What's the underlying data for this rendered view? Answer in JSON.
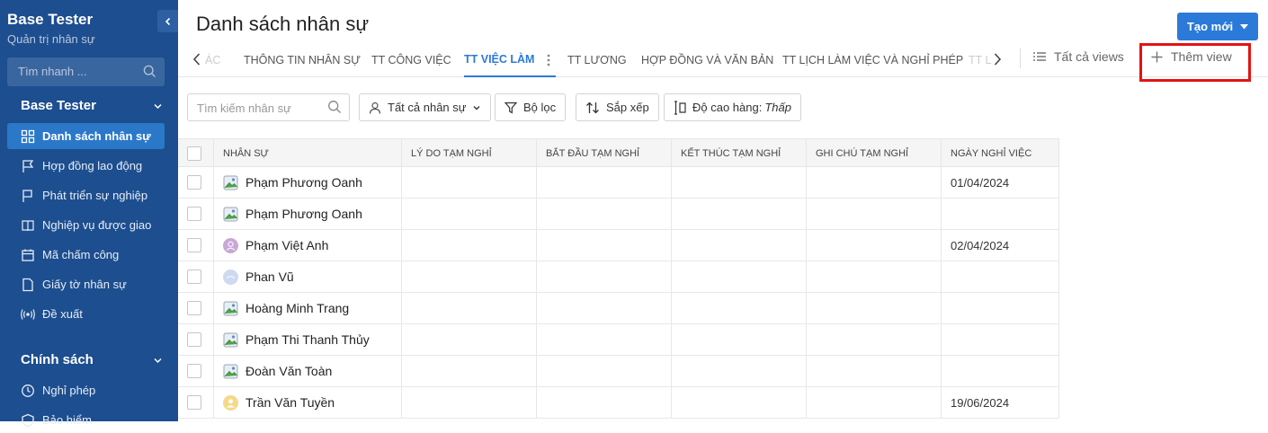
{
  "sidebar": {
    "app_title": "Base Tester",
    "app_subtitle": "Quản trị nhân sự",
    "search_placeholder": "Tìm nhanh ...",
    "section1": "Base Tester",
    "items": [
      {
        "label": "Danh sách nhân sự",
        "icon": "grid-icon",
        "active": true
      },
      {
        "label": "Hợp đồng lao động",
        "icon": "flag-outline-icon"
      },
      {
        "label": "Phát triển sự nghiệp",
        "icon": "flag-icon"
      },
      {
        "label": "Nghiệp vụ được giao",
        "icon": "book-icon"
      },
      {
        "label": "Mã chấm công",
        "icon": "calendar-icon"
      },
      {
        "label": "Giấy tờ nhân sự",
        "icon": "document-icon"
      },
      {
        "label": "Đề xuất",
        "icon": "broadcast-icon"
      }
    ],
    "section2": "Chính sách",
    "items2": [
      {
        "label": "Nghỉ phép",
        "icon": "clock-icon"
      },
      {
        "label": "Bảo hiểm",
        "icon": "shield-icon"
      }
    ]
  },
  "header": {
    "title": "Danh sách nhân sự",
    "create_label": "Tạo mới"
  },
  "tabs": {
    "partial_left": "ÁC",
    "items": [
      "THÔNG TIN NHÂN SỰ",
      "TT CÔNG VIỆC",
      "TT VIỆC LÀM",
      "TT LƯƠNG",
      "HỢP ĐỒNG VÀ VĂN BẢN",
      "TT LỊCH LÀM VIỆC VÀ NGHỈ PHÉP"
    ],
    "partial_right": "TT L",
    "all_views": "Tất cả views",
    "add_view": "Thêm view"
  },
  "filters": {
    "search_placeholder": "Tìm kiếm nhân sự",
    "all_staff": "Tất cả nhân sự",
    "filter": "Bộ lọc",
    "sort": "Sắp xếp",
    "row_height_label": "Độ cao hàng:",
    "row_height_value": "Thấp"
  },
  "table": {
    "columns": [
      "NHÂN SỰ",
      "LÝ DO TẠM NGHỈ",
      "BẮT ĐẦU TẠM NGHỈ",
      "KẾT THÚC TẠM NGHỈ",
      "GHI CHÚ TẠM NGHỈ",
      "NGÀY NGHỈ VIỆC"
    ],
    "rows": [
      {
        "name": "Phạm Phương Oanh",
        "avatar": "image-icon",
        "reason": "",
        "start": "",
        "end": "",
        "note": "",
        "leave_date": "01/04/2024"
      },
      {
        "name": "Phạm Phương Oanh",
        "avatar": "image-icon",
        "reason": "",
        "start": "",
        "end": "",
        "note": "",
        "leave_date": ""
      },
      {
        "name": "Phạm Việt Anh",
        "avatar": "user-purple-icon",
        "reason": "",
        "start": "",
        "end": "",
        "note": "",
        "leave_date": "02/04/2024"
      },
      {
        "name": "Phan Vũ",
        "avatar": "user-blue-icon",
        "reason": "",
        "start": "",
        "end": "",
        "note": "",
        "leave_date": ""
      },
      {
        "name": "Hoàng Minh Trang",
        "avatar": "image-icon",
        "reason": "",
        "start": "",
        "end": "",
        "note": "",
        "leave_date": ""
      },
      {
        "name": "Phạm Thi Thanh Thủy",
        "avatar": "image-icon",
        "reason": "",
        "start": "",
        "end": "",
        "note": "",
        "leave_date": ""
      },
      {
        "name": "Đoàn Văn Toàn",
        "avatar": "image-icon",
        "reason": "",
        "start": "",
        "end": "",
        "note": "",
        "leave_date": ""
      },
      {
        "name": "Trần Văn Tuyền",
        "avatar": "user-yellow-icon",
        "reason": "",
        "start": "",
        "end": "",
        "note": "",
        "leave_date": "19/06/2024"
      }
    ]
  },
  "colors": {
    "sidebar_bg": "#1d4e8f",
    "accent": "#2b7ad9",
    "highlight": "#e31313"
  }
}
